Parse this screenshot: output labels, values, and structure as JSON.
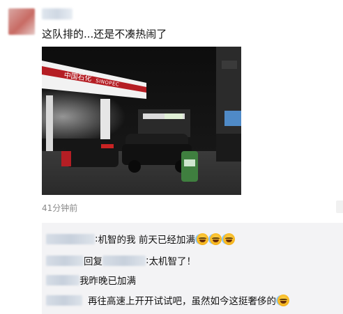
{
  "post": {
    "text": "这队排的...还是不凑热闹了",
    "timestamp": "41分钟前",
    "photo": {
      "sign_cn": "中国石化",
      "sign_en": "SINOPEC"
    }
  },
  "comments": [
    {
      "sep": ": ",
      "text": "机智的我 前天已经加满",
      "emoji_count": 3
    },
    {
      "prefix": "回复",
      "sep": ": ",
      "text": "太机智了！",
      "emoji_count": 0
    },
    {
      "text": "我昨晚已加满",
      "emoji_count": 0
    },
    {
      "text": "再往高速上开开试试吧，虽然如今这挺奢侈的",
      "emoji_count": 1
    }
  ],
  "colors": {
    "background": "#ffffff",
    "comment_bg": "#f3f3f5",
    "timestamp": "#8a8a8a",
    "sinopec_red": "#b51e24"
  },
  "icons": [
    "laughing-tears-icon",
    "more-menu-icon"
  ]
}
